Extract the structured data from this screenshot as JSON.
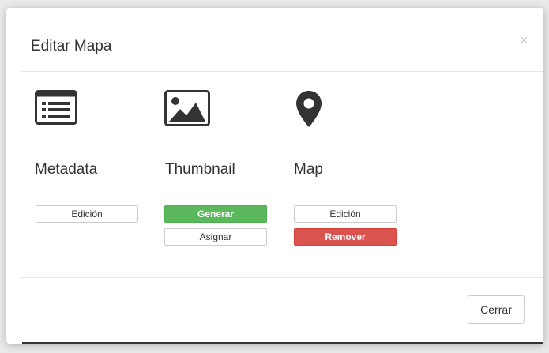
{
  "dialog": {
    "title": "Editar Mapa",
    "close_symbol": "×",
    "footer_button": "Cerrar"
  },
  "sections": [
    {
      "label": "Metadata",
      "icon": "list-icon",
      "buttons": [
        {
          "label": "Edición",
          "style": "default"
        }
      ]
    },
    {
      "label": "Thumbnail",
      "icon": "image-icon",
      "buttons": [
        {
          "label": "Generar",
          "style": "success"
        },
        {
          "label": "Asignar",
          "style": "default"
        }
      ]
    },
    {
      "label": "Map",
      "icon": "map-marker-icon",
      "buttons": [
        {
          "label": "Edición",
          "style": "default"
        },
        {
          "label": "Remover",
          "style": "danger"
        }
      ]
    }
  ],
  "colors": {
    "success": "#5cb85c",
    "danger": "#d9534f",
    "icon": "#333333"
  }
}
